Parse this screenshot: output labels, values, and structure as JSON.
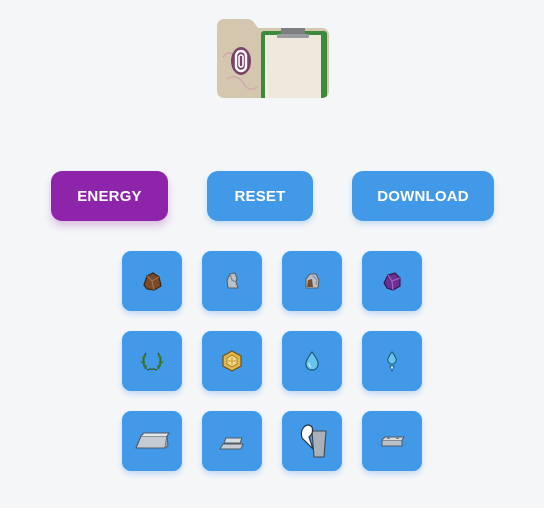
{
  "folder": {
    "icon": "folder-clipboard-thumbnail",
    "badge_icon": "paperclip-badge-icon"
  },
  "buttons": {
    "energy_label": "ENERGY",
    "reset_label": "RESET",
    "download_label": "DOWNLOAD"
  },
  "colors": {
    "primary": "#4299e8",
    "energy": "#8e24aa",
    "background": "#f5f6f8"
  },
  "tiles": [
    {
      "icon": "brown-ore-icon"
    },
    {
      "icon": "grey-stone-icon"
    },
    {
      "icon": "mixed-ore-icon"
    },
    {
      "icon": "purple-crystal-icon"
    },
    {
      "icon": "laurel-wreath-icon"
    },
    {
      "icon": "gold-hexagon-icon"
    },
    {
      "icon": "water-drop-icon"
    },
    {
      "icon": "drip-icon"
    },
    {
      "icon": "metal-ingot-icon"
    },
    {
      "icon": "stacked-ingots-icon"
    },
    {
      "icon": "lightning-cup-icon"
    },
    {
      "icon": "flat-plate-icon"
    }
  ]
}
